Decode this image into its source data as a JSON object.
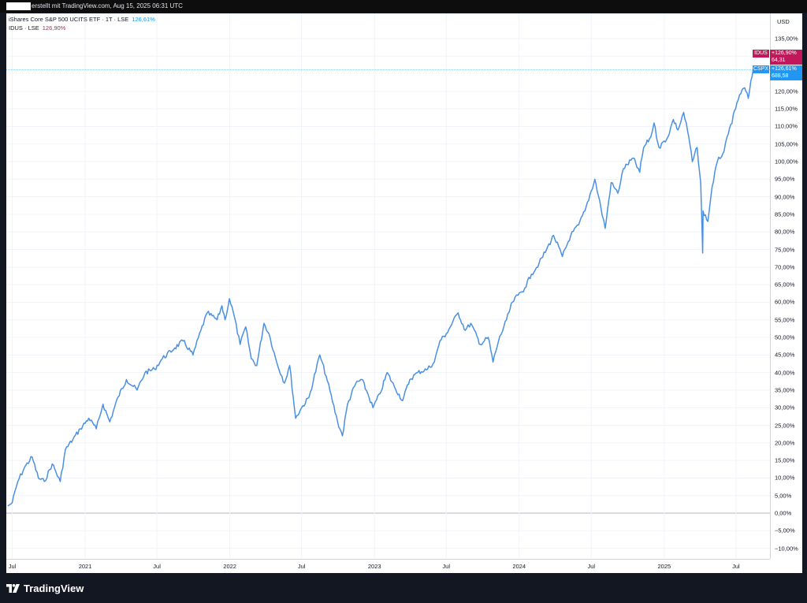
{
  "header": {
    "watermark": "erstellt mit TradingView.com, Aug 15, 2025 06:31 UTC"
  },
  "legend": {
    "series1_label": "iShares Core S&P 500 UCITS ETF · 1T · LSE",
    "series1_value": "126,61%",
    "series2_label": "IDUS · LSE",
    "series2_value": "126,90%"
  },
  "axis": {
    "currency": "USD",
    "y_ticks": [
      "135,00%",
      "130,00%",
      "120,00%",
      "115,00%",
      "110,00%",
      "105,00%",
      "100,00%",
      "95,00%",
      "90,00%",
      "85,00%",
      "80,00%",
      "75,00%",
      "70,00%",
      "65,00%",
      "60,00%",
      "55,00%",
      "50,00%",
      "45,00%",
      "40,00%",
      "35,00%",
      "30,00%",
      "25,00%",
      "20,00%",
      "15,00%",
      "10,00%",
      "5,00%",
      "0,00%",
      "−5,00%",
      "−10,00%"
    ],
    "x_ticks": [
      "Jul",
      "2021",
      "Jul",
      "2022",
      "Jul",
      "2023",
      "Jul",
      "2024",
      "Jul",
      "2025",
      "Jul"
    ]
  },
  "badges": {
    "idus_label": "IDUS",
    "idus_pct": "+126,90%",
    "idus_price": "64,31",
    "cspx_label": "CSPX",
    "cspx_pct": "+126,61%",
    "cspx_price": "688,58"
  },
  "footer": {
    "brand": "TradingView"
  },
  "colors": {
    "line": "#4a90e2",
    "idus": "#c2185b",
    "cspx": "#2196f3"
  },
  "chart_data": {
    "type": "line",
    "x_range": [
      "2020-06",
      "2025-08"
    ],
    "ylim": [
      -12,
      140
    ],
    "y_unit": "%",
    "series": [
      {
        "name": "iShares Core S&P 500 UCITS ETF",
        "points": [
          [
            "2020-06-20",
            2
          ],
          [
            "2020-07-01",
            3
          ],
          [
            "2020-07-15",
            9
          ],
          [
            "2020-08-01",
            13
          ],
          [
            "2020-08-20",
            16
          ],
          [
            "2020-09-05",
            10
          ],
          [
            "2020-09-20",
            9
          ],
          [
            "2020-10-10",
            14
          ],
          [
            "2020-10-30",
            9
          ],
          [
            "2020-11-12",
            18
          ],
          [
            "2020-12-01",
            21
          ],
          [
            "2020-12-20",
            24
          ],
          [
            "2021-01-10",
            27
          ],
          [
            "2021-01-29",
            24
          ],
          [
            "2021-02-15",
            31
          ],
          [
            "2021-03-04",
            26
          ],
          [
            "2021-03-25",
            33
          ],
          [
            "2021-04-15",
            38
          ],
          [
            "2021-05-12",
            35
          ],
          [
            "2021-06-01",
            40
          ],
          [
            "2021-06-25",
            41
          ],
          [
            "2021-07-15",
            44
          ],
          [
            "2021-08-15",
            47
          ],
          [
            "2021-09-05",
            49
          ],
          [
            "2021-09-30",
            45
          ],
          [
            "2021-10-20",
            52
          ],
          [
            "2021-11-05",
            57
          ],
          [
            "2021-11-30",
            55
          ],
          [
            "2021-12-12",
            59
          ],
          [
            "2021-12-20",
            55
          ],
          [
            "2021-12-31",
            61
          ],
          [
            "2022-01-10",
            57
          ],
          [
            "2022-01-27",
            48
          ],
          [
            "2022-02-10",
            53
          ],
          [
            "2022-02-24",
            44
          ],
          [
            "2022-03-10",
            42
          ],
          [
            "2022-03-28",
            54
          ],
          [
            "2022-04-10",
            51
          ],
          [
            "2022-04-29",
            43
          ],
          [
            "2022-05-19",
            37
          ],
          [
            "2022-06-01",
            42
          ],
          [
            "2022-06-16",
            27
          ],
          [
            "2022-07-01",
            30
          ],
          [
            "2022-07-20",
            33
          ],
          [
            "2022-08-16",
            45
          ],
          [
            "2022-09-01",
            39
          ],
          [
            "2022-09-30",
            26
          ],
          [
            "2022-10-12",
            22
          ],
          [
            "2022-10-25",
            31
          ],
          [
            "2022-11-15",
            37
          ],
          [
            "2022-11-30",
            38
          ],
          [
            "2022-12-15",
            34
          ],
          [
            "2022-12-28",
            30
          ],
          [
            "2023-01-15",
            34
          ],
          [
            "2023-02-02",
            40
          ],
          [
            "2023-02-20",
            36
          ],
          [
            "2023-03-13",
            32
          ],
          [
            "2023-03-31",
            38
          ],
          [
            "2023-04-20",
            40
          ],
          [
            "2023-05-15",
            41
          ],
          [
            "2023-06-01",
            43
          ],
          [
            "2023-06-15",
            49
          ],
          [
            "2023-07-01",
            51
          ],
          [
            "2023-07-31",
            57
          ],
          [
            "2023-08-18",
            52
          ],
          [
            "2023-09-01",
            54
          ],
          [
            "2023-09-25",
            48
          ],
          [
            "2023-10-15",
            50
          ],
          [
            "2023-10-27",
            43
          ],
          [
            "2023-11-10",
            49
          ],
          [
            "2023-11-30",
            55
          ],
          [
            "2023-12-15",
            60
          ],
          [
            "2023-12-29",
            62
          ],
          [
            "2024-01-15",
            64
          ],
          [
            "2024-02-01",
            68
          ],
          [
            "2024-02-20",
            71
          ],
          [
            "2024-03-10",
            75
          ],
          [
            "2024-03-28",
            79
          ],
          [
            "2024-04-19",
            73
          ],
          [
            "2024-05-10",
            79
          ],
          [
            "2024-05-30",
            82
          ],
          [
            "2024-06-15",
            86
          ],
          [
            "2024-07-10",
            95
          ],
          [
            "2024-07-25",
            87
          ],
          [
            "2024-08-05",
            81
          ],
          [
            "2024-08-20",
            94
          ],
          [
            "2024-09-06",
            91
          ],
          [
            "2024-09-20",
            98
          ],
          [
            "2024-10-15",
            101
          ],
          [
            "2024-10-31",
            97
          ],
          [
            "2024-11-10",
            104
          ],
          [
            "2024-11-28",
            107
          ],
          [
            "2024-12-06",
            111
          ],
          [
            "2024-12-19",
            104
          ],
          [
            "2025-01-10",
            107
          ],
          [
            "2025-01-24",
            112
          ],
          [
            "2025-02-05",
            109
          ],
          [
            "2025-02-19",
            114
          ],
          [
            "2025-03-04",
            107
          ],
          [
            "2025-03-13",
            100
          ],
          [
            "2025-03-25",
            104
          ],
          [
            "2025-04-03",
            94
          ],
          [
            "2025-04-08",
            74
          ],
          [
            "2025-04-09",
            86
          ],
          [
            "2025-04-21",
            83
          ],
          [
            "2025-05-02",
            93
          ],
          [
            "2025-05-15",
            100
          ],
          [
            "2025-06-01",
            103
          ],
          [
            "2025-06-12",
            108
          ],
          [
            "2025-06-30",
            115
          ],
          [
            "2025-07-10",
            119
          ],
          [
            "2025-07-23",
            121
          ],
          [
            "2025-08-01",
            118
          ],
          [
            "2025-08-14",
            126.61
          ]
        ]
      }
    ]
  }
}
